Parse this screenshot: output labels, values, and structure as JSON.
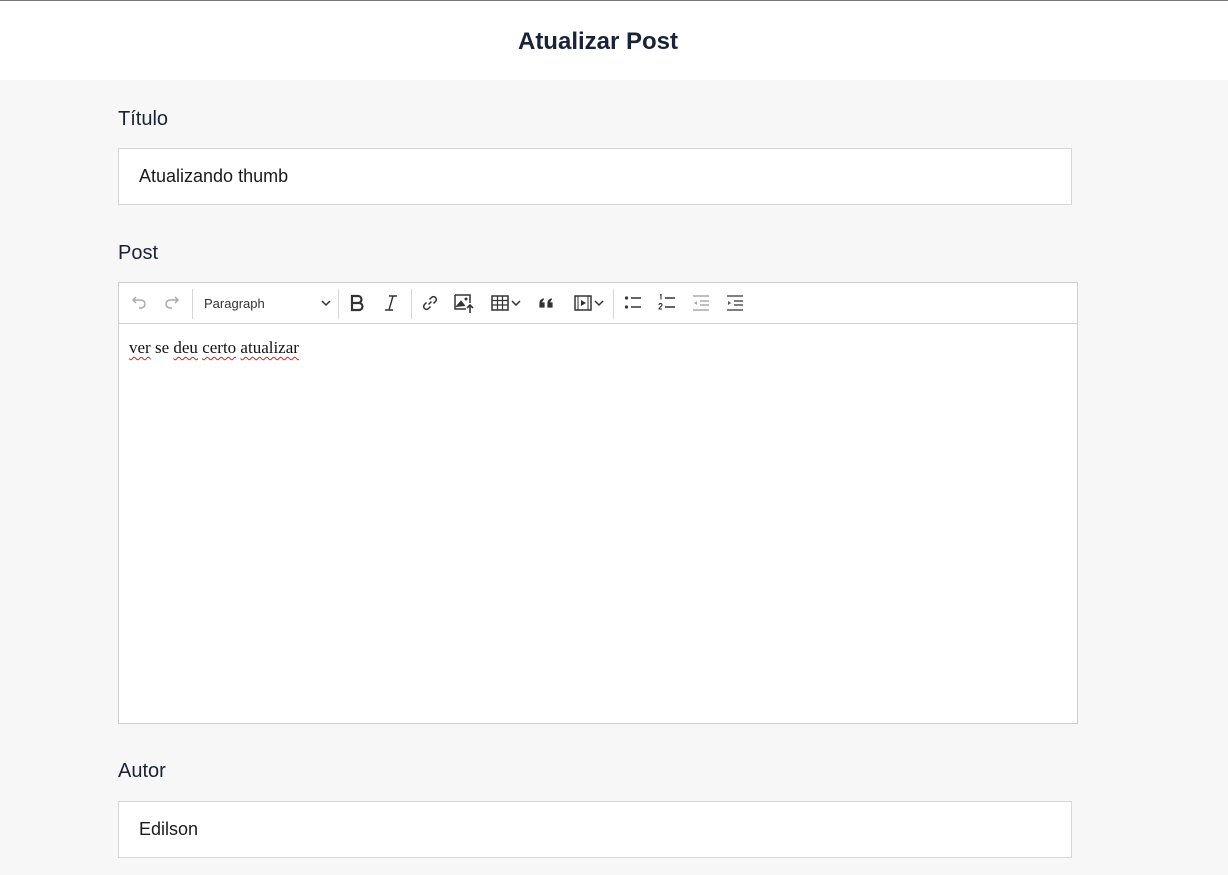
{
  "header": {
    "title": "Atualizar Post"
  },
  "form": {
    "titulo": {
      "label": "Título",
      "value": "Atualizando thumb"
    },
    "post": {
      "label": "Post",
      "toolbar": {
        "paragraph_select": "Paragraph"
      },
      "content_words": [
        "ver",
        "se",
        "deu",
        "certo",
        "atualizar"
      ]
    },
    "autor": {
      "label": "Autor",
      "value": "Edilson"
    }
  },
  "colors": {
    "heading": "#1a2238",
    "spellcheck": "#d42020"
  }
}
